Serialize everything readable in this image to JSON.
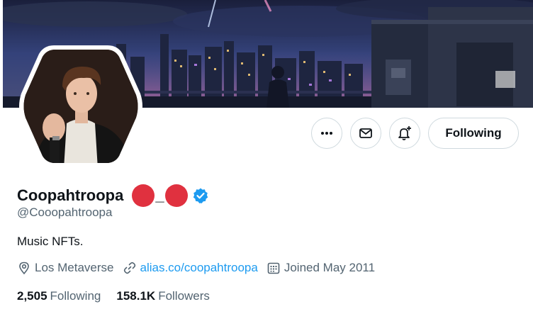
{
  "profile": {
    "display_name": "Coopahtroopa",
    "name_separator": "_",
    "handle": "@Cooopahtroopa",
    "bio": "Music NFTs.",
    "location": "Los Metaverse",
    "website": "alias.co/coopahtroopa",
    "joined": "Joined May 2011"
  },
  "actions": {
    "follow_label": "Following"
  },
  "stats": {
    "following_count": "2,505",
    "following_label": "Following",
    "followers_count": "158.1K",
    "followers_label": "Followers"
  },
  "icons": {
    "more": "more-horizontal-icon",
    "message": "envelope-icon",
    "notify": "bell-plus-icon",
    "verified": "verified-badge-icon",
    "location": "location-pin-icon",
    "link": "link-icon",
    "calendar": "calendar-icon"
  },
  "colors": {
    "accent": "#1d9bf0",
    "emoji_red": "#e0313f",
    "secondary_text": "#536471",
    "border": "#cfd9de"
  }
}
